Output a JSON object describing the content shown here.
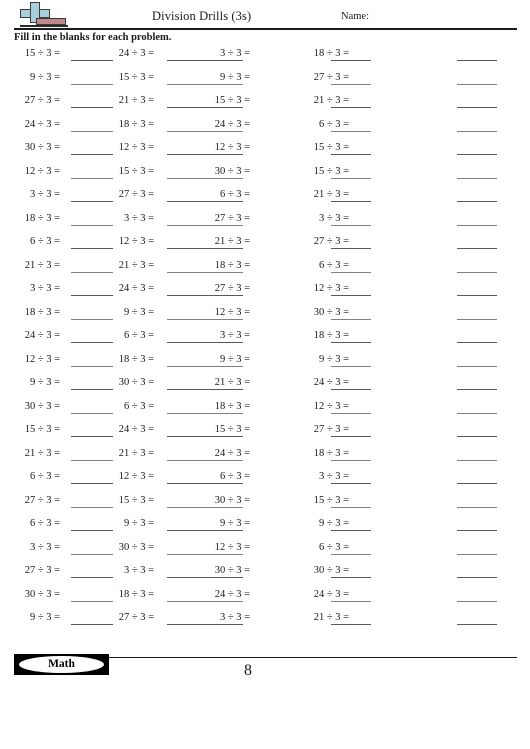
{
  "header": {
    "title": "Division Drills (3s)",
    "name_label": "Name:",
    "logo_icon": "math-plus-logo-icon"
  },
  "instructions": "Fill in the blanks for each problem.",
  "footer": {
    "badge_label": "Math",
    "page_number": "8"
  },
  "worksheet": {
    "divisor": 3,
    "operator": "÷",
    "equals": "=",
    "columns": 4,
    "rows": 25,
    "blank_columns": 5,
    "rows_data": [
      [
        "15 ÷ 3 =",
        "24 ÷ 3 =",
        "3 ÷ 3 =",
        "18 ÷ 3 ="
      ],
      [
        "9 ÷ 3 =",
        "15 ÷ 3 =",
        "9 ÷ 3 =",
        "27 ÷ 3 ="
      ],
      [
        "27 ÷ 3 =",
        "21 ÷ 3 =",
        "15 ÷ 3 =",
        "21 ÷ 3 ="
      ],
      [
        "24 ÷ 3 =",
        "18 ÷ 3 =",
        "24 ÷ 3 =",
        "6 ÷ 3 ="
      ],
      [
        "30 ÷ 3 =",
        "12 ÷ 3 =",
        "12 ÷ 3 =",
        "15 ÷ 3 ="
      ],
      [
        "12 ÷ 3 =",
        "15 ÷ 3 =",
        "30 ÷ 3 =",
        "15 ÷ 3 ="
      ],
      [
        "3 ÷ 3 =",
        "27 ÷ 3 =",
        "6 ÷ 3 =",
        "21 ÷ 3 ="
      ],
      [
        "18 ÷ 3 =",
        "3 ÷ 3 =",
        "27 ÷ 3 =",
        "3 ÷ 3 ="
      ],
      [
        "6 ÷ 3 =",
        "12 ÷ 3 =",
        "21 ÷ 3 =",
        "27 ÷ 3 ="
      ],
      [
        "21 ÷ 3 =",
        "21 ÷ 3 =",
        "18 ÷ 3 =",
        "6 ÷ 3 ="
      ],
      [
        "3 ÷ 3 =",
        "24 ÷ 3 =",
        "27 ÷ 3 =",
        "12 ÷ 3 ="
      ],
      [
        "18 ÷ 3 =",
        "9 ÷ 3 =",
        "12 ÷ 3 =",
        "30 ÷ 3 ="
      ],
      [
        "24 ÷ 3 =",
        "6 ÷ 3 =",
        "3 ÷ 3 =",
        "18 ÷ 3 ="
      ],
      [
        "12 ÷ 3 =",
        "18 ÷ 3 =",
        "9 ÷ 3 =",
        "9 ÷ 3 ="
      ],
      [
        "9 ÷ 3 =",
        "30 ÷ 3 =",
        "21 ÷ 3 =",
        "24 ÷ 3 ="
      ],
      [
        "30 ÷ 3 =",
        "6 ÷ 3 =",
        "18 ÷ 3 =",
        "12 ÷ 3 ="
      ],
      [
        "15 ÷ 3 =",
        "24 ÷ 3 =",
        "15 ÷ 3 =",
        "27 ÷ 3 ="
      ],
      [
        "21 ÷ 3 =",
        "21 ÷ 3 =",
        "24 ÷ 3 =",
        "18 ÷ 3 ="
      ],
      [
        "6 ÷ 3 =",
        "12 ÷ 3 =",
        "6 ÷ 3 =",
        "3 ÷ 3 ="
      ],
      [
        "27 ÷ 3 =",
        "15 ÷ 3 =",
        "30 ÷ 3 =",
        "15 ÷ 3 ="
      ],
      [
        "6 ÷ 3 =",
        "9 ÷ 3 =",
        "9 ÷ 3 =",
        "9 ÷ 3 ="
      ],
      [
        "3 ÷ 3 =",
        "30 ÷ 3 =",
        "12 ÷ 3 =",
        "6 ÷ 3 ="
      ],
      [
        "27 ÷ 3 =",
        "3 ÷ 3 =",
        "30 ÷ 3 =",
        "30 ÷ 3 ="
      ],
      [
        "30 ÷ 3 =",
        "18 ÷ 3 =",
        "24 ÷ 3 =",
        "24 ÷ 3 ="
      ],
      [
        "9 ÷ 3 =",
        "27 ÷ 3 =",
        "3 ÷ 3 =",
        "21 ÷ 3 ="
      ]
    ]
  },
  "colors": {
    "ink": "#1a1a1a",
    "blank_line": "#555a5e",
    "blank_line_light": "#7d8287",
    "logo_blue": "#a8d0dc",
    "logo_red": "#c08a88"
  }
}
